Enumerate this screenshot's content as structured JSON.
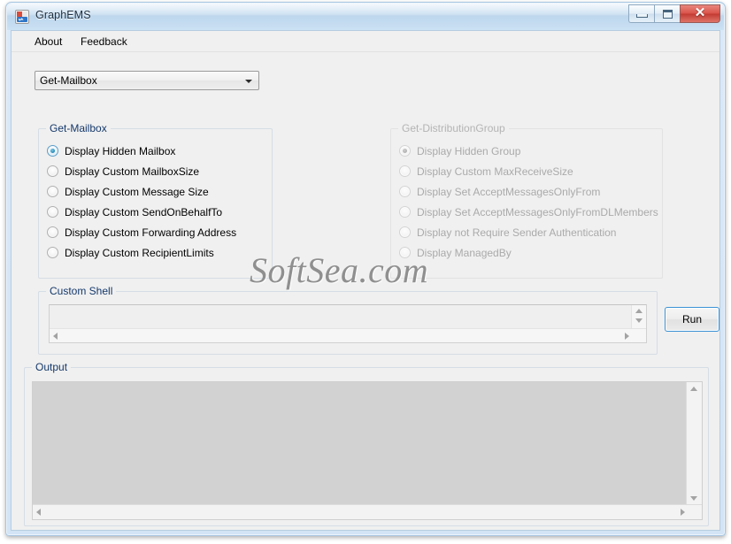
{
  "window": {
    "title": "GraphEMS",
    "icon": "app-icon",
    "controls": {
      "minimize": "minimize-button",
      "maximize": "maximize-button",
      "close_glyph": "✕"
    }
  },
  "menubar": {
    "items": [
      {
        "label": "About"
      },
      {
        "label": "Feedback"
      }
    ]
  },
  "command_select": {
    "value": "Get-Mailbox",
    "options": [
      "Get-Mailbox",
      "Get-DistributionGroup"
    ]
  },
  "mailbox_group": {
    "title": "Get-Mailbox",
    "enabled": true,
    "options": [
      {
        "label": "Display Hidden Mailbox",
        "checked": true
      },
      {
        "label": "Display Custom MailboxSize",
        "checked": false
      },
      {
        "label": "Display Custom Message Size",
        "checked": false
      },
      {
        "label": "Display Custom SendOnBehalfTo",
        "checked": false
      },
      {
        "label": "Display Custom Forwarding Address",
        "checked": false
      },
      {
        "label": "Display Custom RecipientLimits",
        "checked": false
      }
    ]
  },
  "distribution_group": {
    "title": "Get-DistributionGroup",
    "enabled": false,
    "options": [
      {
        "label": "Display Hidden Group",
        "checked": true
      },
      {
        "label": "Display Custom MaxReceiveSize",
        "checked": false
      },
      {
        "label": "Display Set AcceptMessagesOnlyFrom",
        "checked": false
      },
      {
        "label": "Display Set AcceptMessagesOnlyFromDLMembers",
        "checked": false
      },
      {
        "label": "Display not Require Sender Authentication",
        "checked": false
      },
      {
        "label": "Display ManagedBy",
        "checked": false
      }
    ]
  },
  "custom_shell": {
    "title": "Custom Shell",
    "value": "",
    "placeholder": ""
  },
  "run_button": {
    "label": "Run"
  },
  "output": {
    "title": "Output",
    "value": ""
  },
  "watermark": {
    "text": "SoftSea.com"
  },
  "colors": {
    "titlebar": "#c6dcf0",
    "frame": "#d2e4f5",
    "client": "#f0f0f0",
    "group_title": "#15396b",
    "disabled_text": "#aaaaaa",
    "close_button": "#d9544a",
    "focus_border": "#3c93d4",
    "output_background": "#d2d2d2"
  }
}
